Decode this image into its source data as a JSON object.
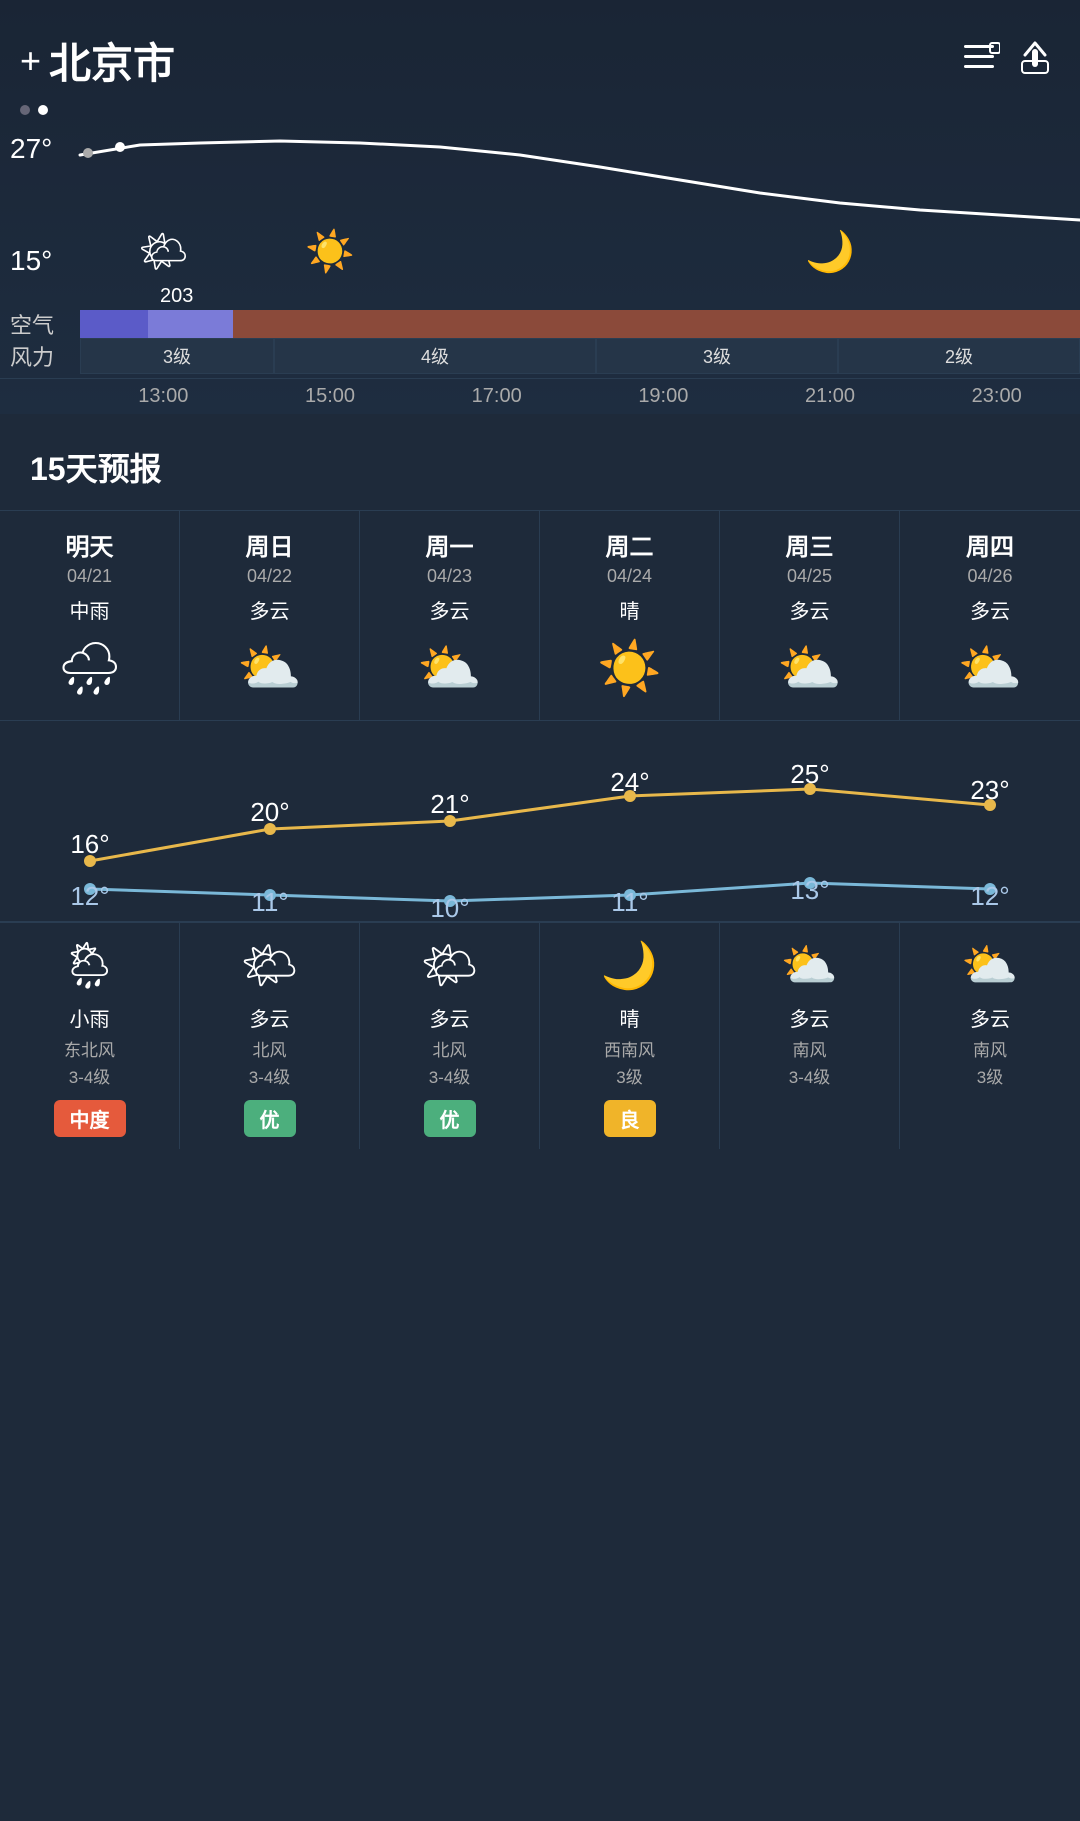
{
  "header": {
    "plus_label": "+",
    "city": "北京市",
    "list_icon": "☰",
    "share_icon": "⬆"
  },
  "hourly_chart": {
    "temp_high": "27°",
    "temp_low": "15°",
    "pagination": [
      "inactive",
      "active"
    ]
  },
  "hourly_slots": [
    {
      "time": "13:00",
      "icon": "🌤",
      "aqi": "203",
      "aqi_color": "purple",
      "wind": "3级"
    },
    {
      "time": "15:00",
      "icon": "☀️",
      "aqi": "",
      "aqi_color": "brown",
      "wind": "4级"
    },
    {
      "time": "17:00",
      "icon": "",
      "aqi": "",
      "aqi_color": "brown",
      "wind": "4级"
    },
    {
      "time": "19:00",
      "icon": "",
      "aqi": "",
      "aqi_color": "brown",
      "wind": "3级"
    },
    {
      "time": "21:00",
      "icon": "🌙",
      "aqi": "",
      "aqi_color": "brown",
      "wind": "3级"
    },
    {
      "time": "23:00",
      "icon": "",
      "aqi": "",
      "aqi_color": "brown",
      "wind": "2级"
    }
  ],
  "section_title": "15天预报",
  "forecast": [
    {
      "day": "明天",
      "date": "04/21",
      "desc_day": "中雨",
      "icon_day": "🌧",
      "temp_high": "16°",
      "temp_low": "12°",
      "icon_night": "🌦",
      "desc_night": "小雨",
      "wind_dir": "东北风",
      "wind_level": "3-4级",
      "aqi_label": "中度",
      "aqi_class": "aqi-bad"
    },
    {
      "day": "周日",
      "date": "04/22",
      "desc_day": "多云",
      "icon_day": "⛅",
      "temp_high": "20°",
      "temp_low": "11°",
      "icon_night": "🌤",
      "desc_night": "多云",
      "wind_dir": "北风",
      "wind_level": "3-4级",
      "aqi_label": "优",
      "aqi_class": "aqi-good"
    },
    {
      "day": "周一",
      "date": "04/23",
      "desc_day": "多云",
      "icon_day": "⛅",
      "temp_high": "21°",
      "temp_low": "10°",
      "icon_night": "🌤",
      "desc_night": "多云",
      "wind_dir": "北风",
      "wind_level": "3-4级",
      "aqi_label": "优",
      "aqi_class": "aqi-good"
    },
    {
      "day": "周二",
      "date": "04/24",
      "desc_day": "晴",
      "icon_day": "☀️",
      "temp_high": "24°",
      "temp_low": "11°",
      "icon_night": "🌙",
      "desc_night": "晴",
      "wind_dir": "西南风",
      "wind_level": "3级",
      "aqi_label": "良",
      "aqi_class": "aqi-moderate"
    },
    {
      "day": "周三",
      "date": "04/25",
      "desc_day": "多云",
      "icon_day": "⛅",
      "temp_high": "25°",
      "temp_low": "13°",
      "icon_night": "⛅",
      "desc_night": "多云",
      "wind_dir": "南风",
      "wind_level": "3-4级",
      "aqi_label": "",
      "aqi_class": ""
    },
    {
      "day": "周四",
      "date": "04/26",
      "desc_day": "多云",
      "icon_day": "⛅",
      "temp_high": "23°",
      "temp_low": "12°",
      "icon_night": "⛅",
      "desc_night": "多云",
      "wind_dir": "南风",
      "wind_level": "3级",
      "aqi_label": "",
      "aqi_class": ""
    }
  ],
  "labels": {
    "air": "空气",
    "wind": "风力"
  }
}
